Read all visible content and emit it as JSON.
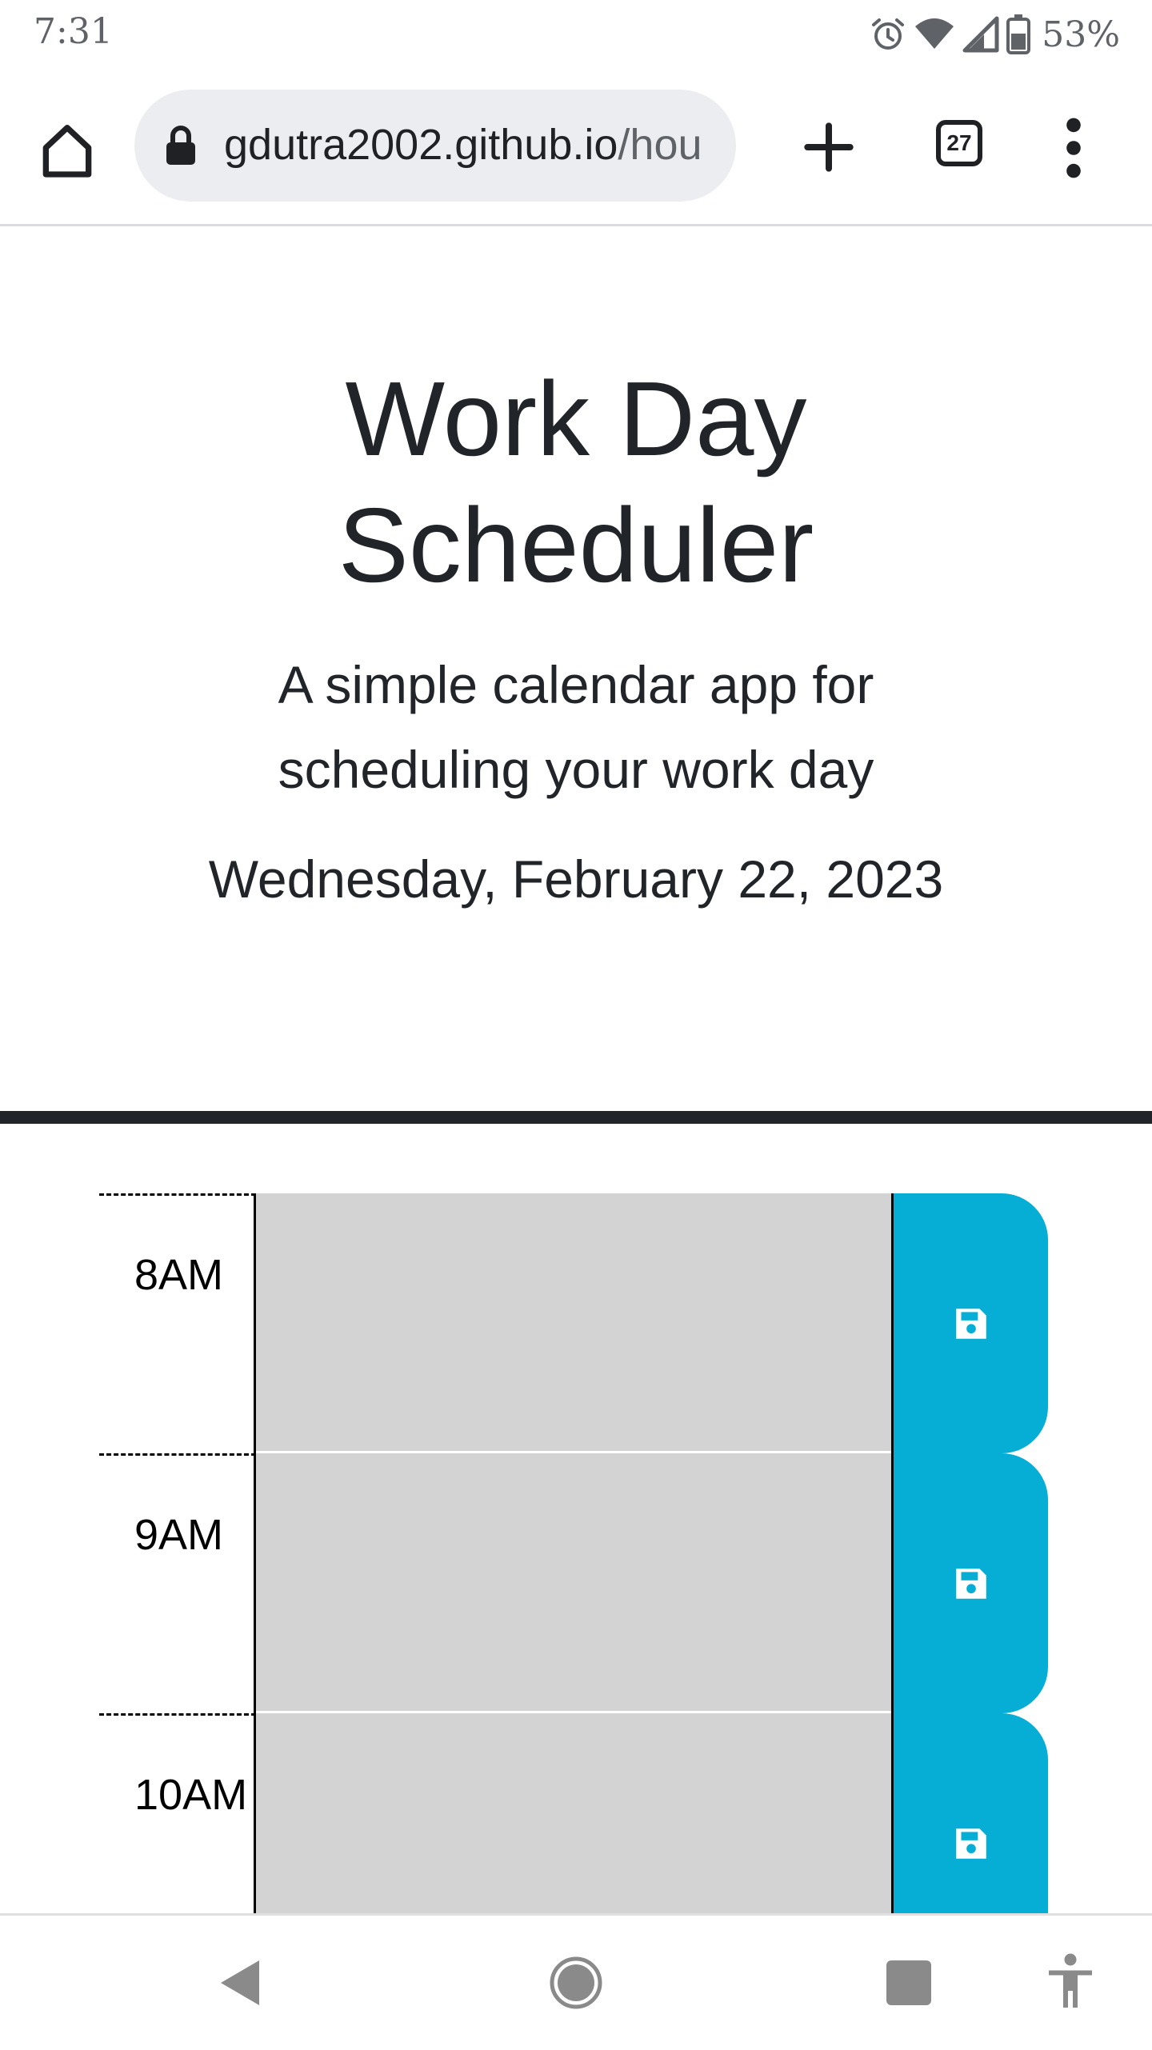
{
  "status_bar": {
    "time": "7:31",
    "battery": "53%",
    "icons": [
      "alarm-icon",
      "wifi-icon",
      "cell-signal-icon",
      "battery-icon"
    ]
  },
  "browser": {
    "url_host": "gdutra2002.github.io",
    "url_path": "/hou",
    "tab_count": "27",
    "icons": [
      "home-icon",
      "lock-icon",
      "plus-icon",
      "tab-switcher-icon",
      "more-vert-icon"
    ]
  },
  "header": {
    "title": "Work Day Scheduler",
    "lead": "A simple calendar app for scheduling your work day",
    "current_day": "Wednesday, February 22, 2023"
  },
  "schedule": {
    "rows": [
      {
        "hour": "8AM",
        "description": ""
      },
      {
        "hour": "9AM",
        "description": ""
      },
      {
        "hour": "10AM",
        "description": ""
      }
    ],
    "save_icon": "floppy-disk-icon"
  },
  "colors": {
    "past_block": "#d3d3d3",
    "save_button": "#06aed5",
    "header_border": "#212529"
  },
  "nav_bar": {
    "icons": [
      "back-icon",
      "home-circle-icon",
      "recents-icon",
      "accessibility-icon"
    ]
  }
}
